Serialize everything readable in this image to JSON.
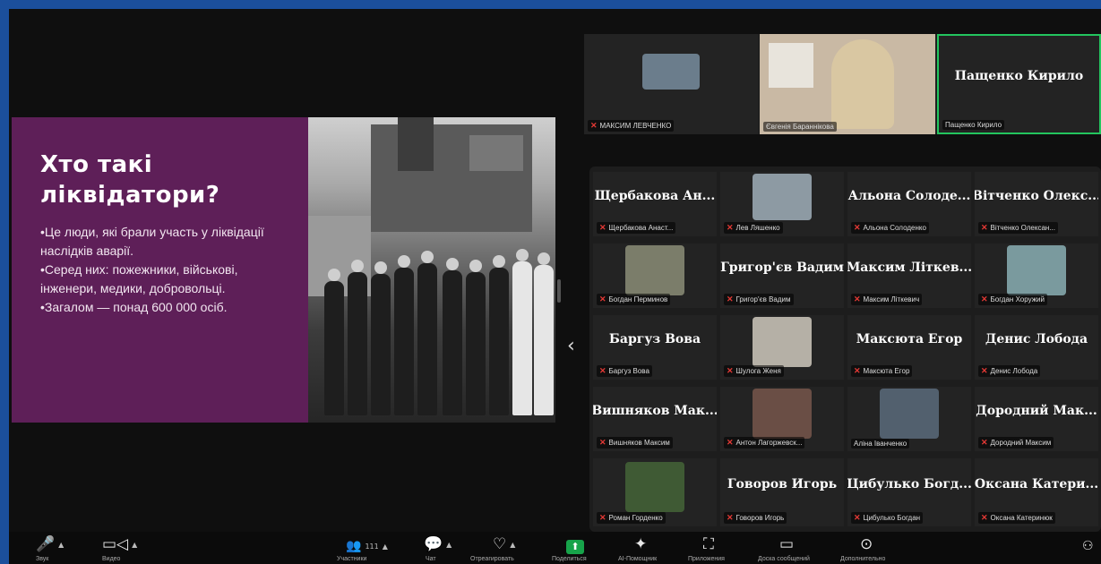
{
  "slide": {
    "title": "Хто такі\nліквідатори?",
    "bullets": [
      "•Це люди, які брали участь у ліквідації наслідків аварії.",
      "•Серед них: пожежники, військові, інженери, медики, добровольці.",
      "•Загалом — понад 600 000 осіб."
    ]
  },
  "top_strip": [
    {
      "label": "МАКСИМ ЛЕВЧЕНКО",
      "type": "photo",
      "color": "#6b7d8c"
    },
    {
      "label": "Євгенія Бараннікова",
      "type": "video",
      "color": "#c9b9a4"
    },
    {
      "label": "Пащенко Кирило",
      "name": "Пащенко Кирило",
      "type": "name",
      "active": true
    }
  ],
  "gallery": [
    [
      {
        "name": "Щербакова Ан...",
        "label": "Щербакова Анаст..."
      },
      {
        "label": "Лев Ляшенко",
        "type": "photo",
        "color": "#8d9aa3"
      },
      {
        "name": "Альона Солоде...",
        "label": "Альона Солоденко"
      },
      {
        "name": "Вітченко Олекс...",
        "label": "Вітченко Олексан..."
      }
    ],
    [
      {
        "label": "Богдан Перминов",
        "type": "photo",
        "color": "#7b7d6a"
      },
      {
        "name": "Григор'єв Вадим",
        "label": "Григор'єв Вадим"
      },
      {
        "name": "Максим Літкев...",
        "label": "Максим Літкевич"
      },
      {
        "label": "Богдан Хоружий",
        "type": "photo",
        "color": "#7a9a9e"
      }
    ],
    [
      {
        "name": "Баргуз Вова",
        "label": "Баргуз Вова"
      },
      {
        "label": "Шулога Женя",
        "type": "photo",
        "color": "#b5b0a6"
      },
      {
        "name": "Максюта Егор",
        "label": "Максюта Егор"
      },
      {
        "name": "Денис Лобода",
        "label": "Денис Лобода"
      }
    ],
    [
      {
        "name": "Вишняков Мак...",
        "label": "Вишняков Максим"
      },
      {
        "label": "Антон Лагоржевск...",
        "type": "photo",
        "color": "#6a4e45"
      },
      {
        "label": "Аліна Іванченко",
        "type": "photo",
        "color": "#52606e"
      },
      {
        "name": "Дородний Мак...",
        "label": "Дородний Максим"
      }
    ],
    [
      {
        "label": "Роман Горденко",
        "type": "photo",
        "color": "#3f5a34"
      },
      {
        "name": "Говоров Игорь",
        "label": "Говоров Игорь"
      },
      {
        "name": "Цибулько Богд...",
        "label": "Цибулько Богдан"
      },
      {
        "name": "Оксана Катери...",
        "label": "Оксана Катеринюк"
      }
    ]
  ],
  "toolbar": {
    "participants_count": "111",
    "labels": [
      "Звук",
      "Видео",
      "Участники",
      "Чат",
      "Отреагировать",
      "Поделиться",
      "AI-Помощник",
      "Приложения",
      "Доска сообщений",
      "Дополнительно"
    ]
  },
  "colors": {
    "accent_green": "#17a34a",
    "slide_purple": "#5e1f58",
    "mic_red": "#e53935"
  }
}
